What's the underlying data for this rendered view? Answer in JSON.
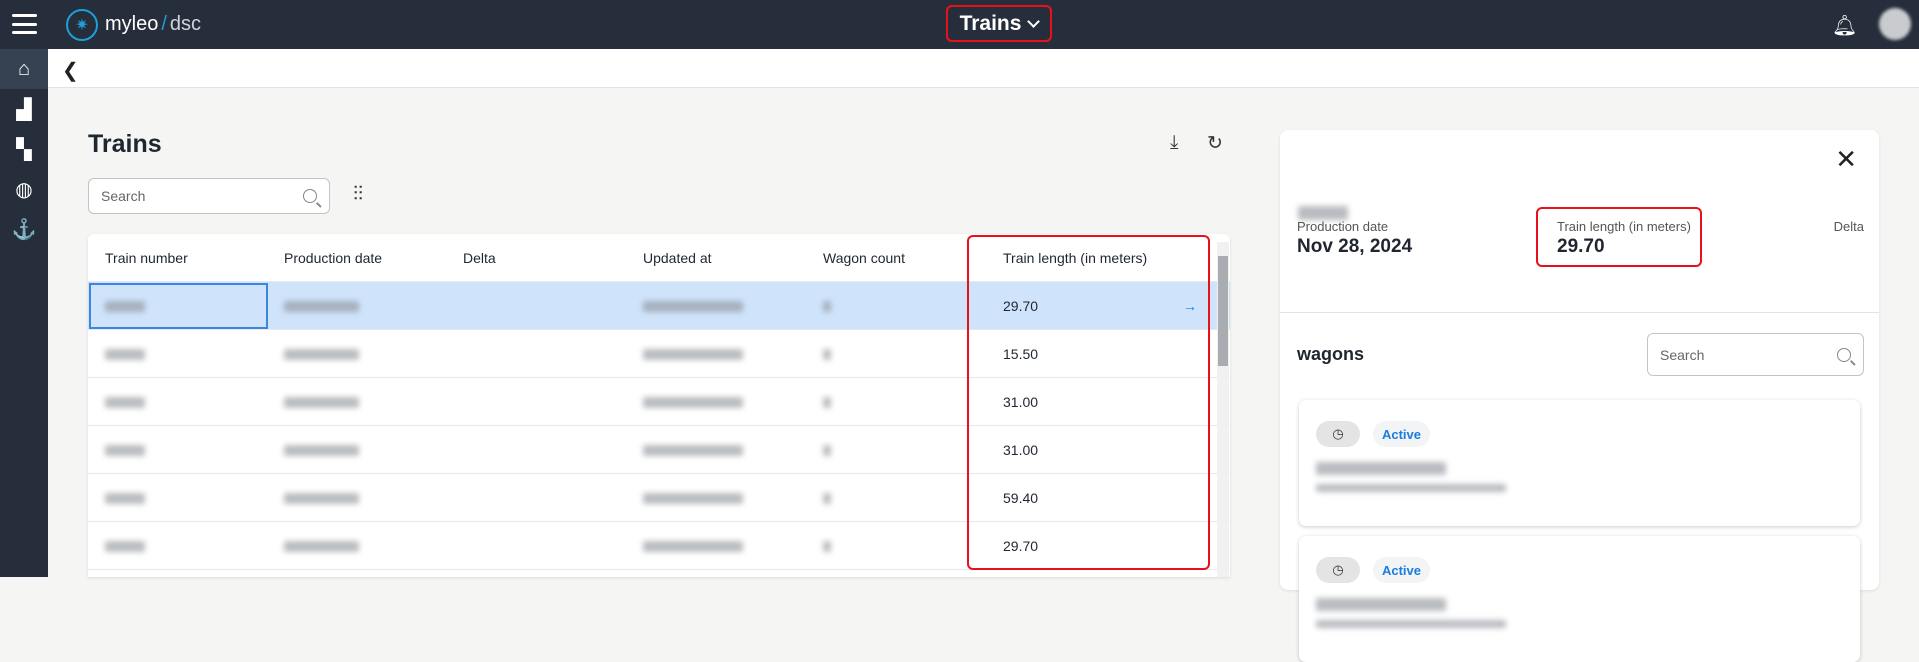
{
  "header": {
    "brand_main": "myleo",
    "brand_sep": "/",
    "brand_sub": "dsc",
    "app_title": "Trains"
  },
  "sidebar": {
    "items": [
      {
        "icon": "home-icon",
        "glyph": "⌂"
      },
      {
        "icon": "chart-icon",
        "glyph": "▟"
      },
      {
        "icon": "dashboard-icon",
        "glyph": "▚"
      },
      {
        "icon": "globe-icon",
        "glyph": "◍"
      },
      {
        "icon": "anchor-icon",
        "glyph": "⚓"
      }
    ]
  },
  "page": {
    "title": "Trains",
    "search_placeholder": "Search"
  },
  "table": {
    "columns": [
      "Train number",
      "Production date",
      "Delta",
      "Updated at",
      "Wagon count",
      "Train length (in meters)"
    ],
    "rows": [
      {
        "length": "29.70",
        "selected": true
      },
      {
        "length": "15.50"
      },
      {
        "length": "31.00"
      },
      {
        "length": "31.00"
      },
      {
        "length": "59.40"
      },
      {
        "length": "29.70"
      }
    ]
  },
  "panel": {
    "production_date_label": "Production date",
    "production_date": "Nov 28, 2024",
    "train_length_label": "Train length (in meters)",
    "train_length": "29.70",
    "delta_label": "Delta",
    "wagons_title": "wagons",
    "wagons_search_placeholder": "Search",
    "wagons": [
      {
        "status": "Active"
      },
      {
        "status": "Active"
      }
    ]
  },
  "colors": {
    "topbar": "#252e3a",
    "accent": "#1a7de0",
    "highlight": "#e8101a",
    "selected_row": "#cfe3fb"
  }
}
